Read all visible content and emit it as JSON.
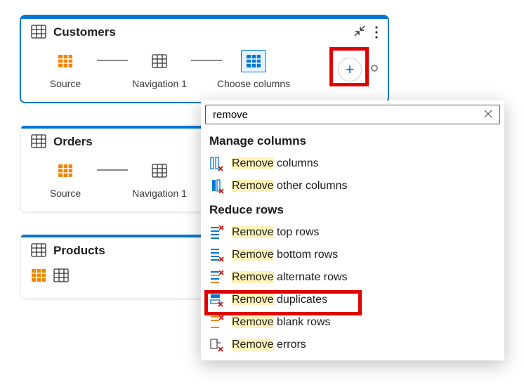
{
  "queries": {
    "customers": {
      "title": "Customers",
      "steps": [
        {
          "label": "Source"
        },
        {
          "label": "Navigation 1"
        },
        {
          "label": "Choose columns"
        }
      ]
    },
    "orders": {
      "title": "Orders",
      "steps": [
        {
          "label": "Source"
        },
        {
          "label": "Navigation 1"
        }
      ]
    },
    "products": {
      "title": "Products"
    }
  },
  "menu": {
    "search_value": "remove",
    "sections": [
      {
        "title": "Manage columns",
        "items": [
          {
            "hl": "Remove",
            "rest": " columns",
            "icon": "remove-columns"
          },
          {
            "hl": "Remove",
            "rest": " other columns",
            "icon": "remove-other-columns"
          }
        ]
      },
      {
        "title": "Reduce rows",
        "items": [
          {
            "hl": "Remove",
            "rest": " top rows",
            "icon": "remove-top-rows"
          },
          {
            "hl": "Remove",
            "rest": " bottom rows",
            "icon": "remove-bottom-rows"
          },
          {
            "hl": "Remove",
            "rest": " alternate rows",
            "icon": "remove-alt-rows"
          },
          {
            "hl": "Remove",
            "rest": " duplicates",
            "icon": "remove-duplicates"
          },
          {
            "hl": "Remove",
            "rest": " blank rows",
            "icon": "remove-blank-rows"
          },
          {
            "hl": "Remove",
            "rest": " errors",
            "icon": "remove-errors"
          }
        ]
      }
    ]
  }
}
